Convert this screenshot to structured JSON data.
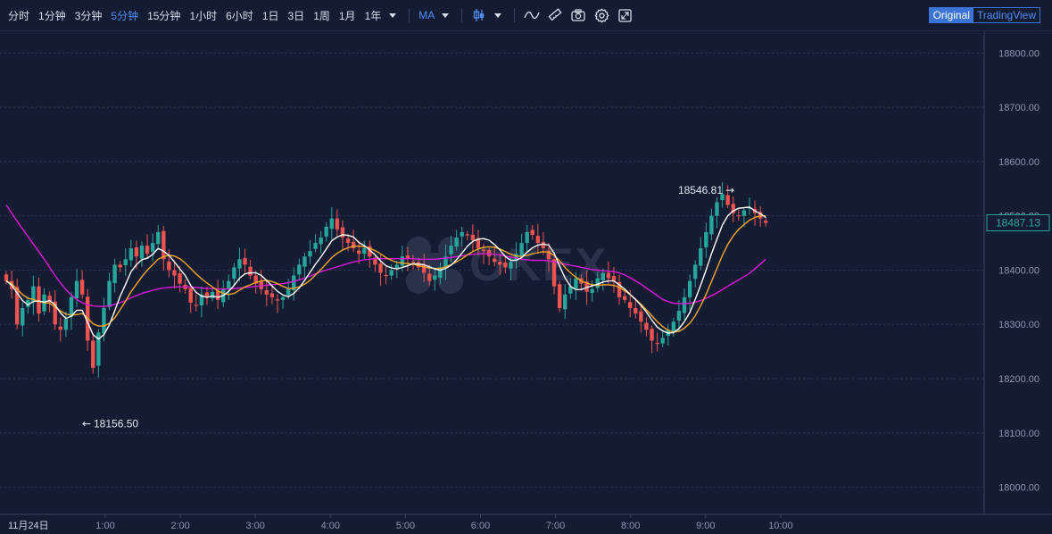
{
  "toolbar": {
    "timeframes": [
      "分时",
      "1分钟",
      "3分钟",
      "5分钟",
      "15分钟",
      "1小时",
      "6小时",
      "1日",
      "3日",
      "1周",
      "1月",
      "1年"
    ],
    "active_timeframe": "5分钟",
    "indicator": "MA",
    "icons": [
      "candle-type-icon",
      "line-draw-icon",
      "ruler-icon",
      "camera-icon",
      "gear-icon",
      "fullscreen-icon"
    ],
    "view_original": "Original",
    "view_tradingview": "TradingView"
  },
  "watermark": "OKEX",
  "colors": {
    "background": "#141c33",
    "up": "#26a69a",
    "down": "#ef5350",
    "ma_fast": "#ffffff",
    "ma_mid": "#f5a623",
    "ma_slow": "#d81ad8",
    "accent": "#4f8df5"
  },
  "chart_data": {
    "type": "candlestick",
    "date_label": "11月24日",
    "time_ticks": [
      "1:00",
      "2:00",
      "3:00",
      "4:00",
      "5:00",
      "6:00",
      "7:00",
      "8:00",
      "9:00",
      "10:00"
    ],
    "price_ticks": [
      "18800.00",
      "18700.00",
      "18600.00",
      "18500.00",
      "18400.00",
      "18300.00",
      "18200.00",
      "18100.00",
      "18000.00"
    ],
    "ylim": [
      17950,
      18840
    ],
    "grid": true,
    "current_price": "18487.13",
    "high_label": "18546.81",
    "low_label": "18156.50",
    "closes": [
      18380,
      18365,
      18300,
      18330,
      18345,
      18370,
      18320,
      18355,
      18340,
      18300,
      18290,
      18310,
      18350,
      18380,
      18355,
      18270,
      18220,
      18285,
      18330,
      18380,
      18410,
      18405,
      18420,
      18440,
      18425,
      18445,
      18430,
      18450,
      18470,
      18420,
      18400,
      18390,
      18375,
      18365,
      18340,
      18335,
      18355,
      18350,
      18360,
      18345,
      18365,
      18380,
      18405,
      18420,
      18410,
      18390,
      18375,
      18365,
      18355,
      18350,
      18345,
      18350,
      18365,
      18390,
      18410,
      18425,
      18435,
      18450,
      18460,
      18480,
      18495,
      18475,
      18460,
      18450,
      18440,
      18430,
      18440,
      18425,
      18410,
      18395,
      18390,
      18400,
      18410,
      18425,
      18420,
      18415,
      18405,
      18395,
      18380,
      18390,
      18405,
      18425,
      18445,
      18460,
      18470,
      18465,
      18455,
      18440,
      18435,
      18425,
      18415,
      18410,
      18405,
      18415,
      18430,
      18450,
      18470,
      18465,
      18450,
      18440,
      18420,
      18370,
      18330,
      18355,
      18370,
      18385,
      18375,
      18360,
      18365,
      18385,
      18395,
      18385,
      18380,
      18350,
      18345,
      18330,
      18320,
      18305,
      18290,
      18270,
      18265,
      18275,
      18290,
      18305,
      18325,
      18350,
      18380,
      18410,
      18440,
      18470,
      18500,
      18525,
      18540,
      18520,
      18505,
      18500,
      18510,
      18515,
      18505,
      18495,
      18487.13
    ],
    "ma_fast": [
      18380,
      18372,
      18358,
      18344,
      18336,
      18342,
      18343,
      18341,
      18344,
      18336,
      18321,
      18311,
      18315,
      18326,
      18326,
      18304,
      18281,
      18273,
      18281,
      18299,
      18325,
      18352,
      18374,
      18397,
      18410,
      18419,
      18422,
      18429,
      18440,
      18435,
      18427,
      18415,
      18402,
      18390,
      18372,
      18359,
      18352,
      18350,
      18352,
      18350,
      18353,
      18361,
      18372,
      18385,
      18393,
      18395,
      18395,
      18390,
      18381,
      18371,
      18361,
      18354,
      18351,
      18357,
      18367,
      18381,
      18396,
      18411,
      18424,
      18439,
      18454,
      18461,
      18465,
      18464,
      18461,
      18451,
      18445,
      18437,
      18428,
      18417,
      18408,
      18404,
      18402,
      18405,
      18408,
      18412,
      18411,
      18410,
      18406,
      18402,
      18400,
      18403,
      18409,
      18419,
      18431,
      18444,
      18453,
      18457,
      18458,
      18455,
      18447,
      18437,
      18425,
      18418,
      18418,
      18423,
      18433,
      18441,
      18446,
      18448,
      18446,
      18431,
      18407,
      18386,
      18370,
      18364,
      18364,
      18368,
      18371,
      18374,
      18378,
      18380,
      18380,
      18373,
      18365,
      18355,
      18346,
      18335,
      18323,
      18308,
      18295,
      18288,
      18284,
      18285,
      18292,
      18305,
      18322,
      18346,
      18372,
      18400,
      18430,
      18457,
      18483,
      18500,
      18509,
      18514,
      18515,
      18516,
      18509,
      18504,
      18497
    ],
    "ma_mid": [
      18380,
      18375,
      18365,
      18355,
      18348,
      18346,
      18342,
      18340,
      18339,
      18332,
      18325,
      18319,
      18317,
      18318,
      18320,
      18312,
      18301,
      18297,
      18297,
      18302,
      18312,
      18327,
      18343,
      18360,
      18374,
      18388,
      18400,
      18410,
      18420,
      18425,
      18427,
      18426,
      18421,
      18413,
      18403,
      18393,
      18384,
      18376,
      18369,
      18362,
      18357,
      18355,
      18357,
      18363,
      18369,
      18373,
      18377,
      18380,
      18381,
      18379,
      18375,
      18370,
      18366,
      18366,
      18369,
      18374,
      18381,
      18391,
      18401,
      18412,
      18423,
      18431,
      18437,
      18441,
      18444,
      18444,
      18443,
      18440,
      18436,
      18430,
      18423,
      18418,
      18414,
      18413,
      18412,
      18411,
      18408,
      18406,
      18404,
      18403,
      18403,
      18406,
      18410,
      18415,
      18421,
      18428,
      18434,
      18439,
      18442,
      18443,
      18442,
      18439,
      18434,
      18429,
      18426,
      18425,
      18427,
      18430,
      18432,
      18434,
      18433,
      18427,
      18417,
      18405,
      18395,
      18387,
      18380,
      18376,
      18373,
      18372,
      18373,
      18373,
      18372,
      18368,
      18362,
      18355,
      18346,
      18337,
      18327,
      18316,
      18305,
      18296,
      18289,
      18286,
      18287,
      18293,
      18302,
      18316,
      18334,
      18355,
      18379,
      18403,
      18427,
      18447,
      18463,
      18475,
      18484,
      18492,
      18497,
      18500,
      18500
    ],
    "ma_slow": [
      18520,
      18505,
      18490,
      18476,
      18462,
      18448,
      18434,
      18420,
      18405,
      18390,
      18376,
      18364,
      18354,
      18346,
      18340,
      18336,
      18334,
      18333,
      18333,
      18334,
      18337,
      18340,
      18344,
      18349,
      18353,
      18357,
      18360,
      18363,
      18365,
      18367,
      18368,
      18369,
      18369,
      18369,
      18369,
      18368,
      18367,
      18366,
      18366,
      18365,
      18365,
      18365,
      18366,
      18367,
      18368,
      18369,
      18370,
      18371,
      18372,
      18373,
      18374,
      18375,
      18377,
      18379,
      18382,
      18385,
      18389,
      18393,
      18397,
      18400,
      18403,
      18406,
      18409,
      18412,
      18415,
      18417,
      18419,
      18420,
      18421,
      18421,
      18421,
      18421,
      18421,
      18421,
      18421,
      18421,
      18420,
      18420,
      18420,
      18420,
      18421,
      18422,
      18423,
      18425,
      18426,
      18428,
      18429,
      18430,
      18430,
      18430,
      18429,
      18428,
      18426,
      18424,
      18422,
      18420,
      18419,
      18418,
      18418,
      18418,
      18417,
      18415,
      18413,
      18411,
      18409,
      18407,
      18405,
      18403,
      18401,
      18400,
      18399,
      18398,
      18397,
      18395,
      18391,
      18386,
      18380,
      18374,
      18367,
      18360,
      18353,
      18346,
      18342,
      18339,
      18338,
      18338,
      18339,
      18341,
      18344,
      18348,
      18353,
      18358,
      18364,
      18370,
      18376,
      18382,
      18388,
      18394,
      18402,
      18411,
      18420
    ]
  }
}
